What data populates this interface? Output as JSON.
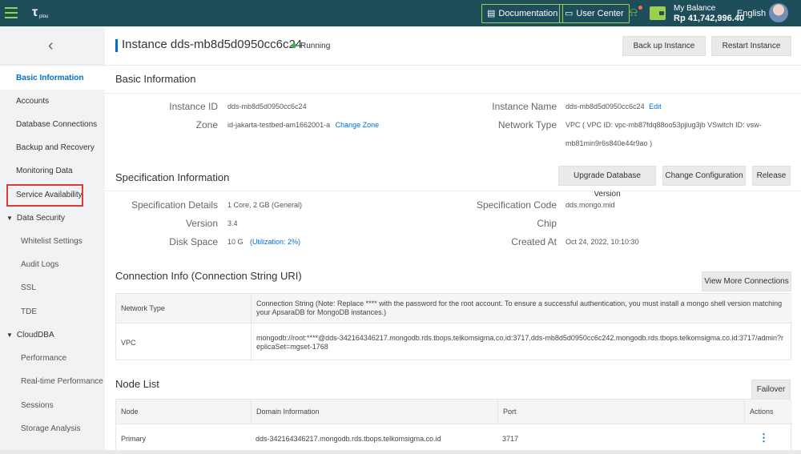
{
  "topbar": {
    "logo_text": "plou",
    "documentation_label": "Documentation",
    "user_center_label": "User Center",
    "balance_label": "My Balance",
    "balance_value": "Rp 41,742,996.40",
    "language": "English",
    "colors": {
      "bg": "#1f4e5b",
      "accent": "#9bd14a",
      "notify": "#ff6a5a"
    }
  },
  "sidebar": {
    "items": [
      {
        "label": "Basic Information",
        "active": true
      },
      {
        "label": "Accounts"
      },
      {
        "label": "Database Connections"
      },
      {
        "label": "Backup and Recovery"
      },
      {
        "label": "Monitoring Data"
      },
      {
        "label": "Service Availability"
      },
      {
        "label": "Data Security"
      },
      {
        "label": "Whitelist Settings"
      },
      {
        "label": "Audit Logs"
      },
      {
        "label": "SSL"
      },
      {
        "label": "TDE"
      },
      {
        "label": "CloudDBA"
      },
      {
        "label": "Performance"
      },
      {
        "label": "Real-time Performance"
      },
      {
        "label": "Sessions"
      },
      {
        "label": "Storage Analysis"
      }
    ]
  },
  "header": {
    "title": "Instance dds-mb8d5d0950cc6c24",
    "status": "Running",
    "backup_label": "Back up Instance",
    "restart_label": "Restart Instance"
  },
  "basic": {
    "section_title": "Basic Information",
    "instance_id_label": "Instance ID",
    "instance_id": "dds-mb8d5d0950cc6c24",
    "zone_label": "Zone",
    "zone": "id-jakarta-testbed-am1662001-a",
    "change_zone": "Change Zone",
    "instance_name_label": "Instance Name",
    "instance_name": "dds-mb8d5d0950cc6c24",
    "edit": "Edit",
    "network_type_label": "Network Type",
    "network_type_line1": "VPC ( VPC ID: vpc-mb87fdq88oo53pjiug3jb VSwitch ID: vsw-",
    "network_type_line2": "mb81min9r6s840e44r9ao )"
  },
  "spec": {
    "section_title": "Specification Information",
    "upgrade_label": "Upgrade Database Version",
    "change_config_label": "Change Configuration",
    "release_label": "Release",
    "details_label": "Specification Details",
    "details": "1 Core, 2 GB (General)",
    "version_label": "Version",
    "version": "3.4",
    "disk_label": "Disk Space",
    "disk": "10 G",
    "utilization": "(Utilization: 2%)",
    "code_label": "Specification Code",
    "code": "dds.mongo.mid",
    "chip_label": "Chip",
    "created_label": "Created At",
    "created": "Oct 24, 2022, 10:10:30"
  },
  "connection": {
    "section_title": "Connection Info (Connection String URI)",
    "view_more_label": "View More Connections",
    "col_network_type": "Network Type",
    "col_connection_string": "Connection String (Note: Replace **** with the password for the root account. To ensure a successful authentication, you must install a mongo shell version matching your ApsaraDB for MongoDB instances.)",
    "row_type": "VPC",
    "row_value": "mongodb://root:****@dds-342164346217.mongodb.rds.tbops.telkomsigma.co.id:3717,dds-mb8d5d0950cc6c242.mongodb.rds.tbops.telkomsigma.co.id:3717/admin?replicaSet=mgset-1768"
  },
  "nodes": {
    "section_title": "Node List",
    "failover_label": "Failover",
    "columns": {
      "node": "Node",
      "domain": "Domain Information",
      "port": "Port",
      "actions": "Actions"
    },
    "rows": [
      {
        "node": "Primary",
        "domain": "dds-342164346217.mongodb.rds.tbops.telkomsigma.co.id",
        "port": "3717"
      }
    ]
  }
}
